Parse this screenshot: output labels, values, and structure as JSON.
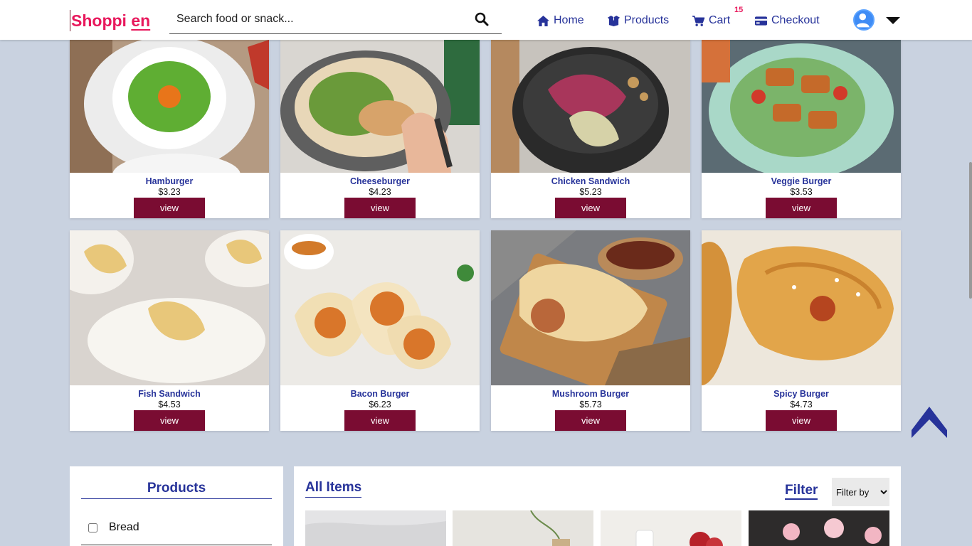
{
  "navbar": {
    "brand_part1": "Shoppi ",
    "brand_part2": "en",
    "search_placeholder": "Search food or snack...",
    "search_icon": "search-icon",
    "links": [
      {
        "label": "Home",
        "icon": "home-icon"
      },
      {
        "label": "Products",
        "icon": "box-icon"
      },
      {
        "label": "Cart",
        "icon": "cart-icon"
      },
      {
        "label": "Checkout",
        "icon": "credit-card-icon"
      }
    ],
    "cart_count": "15"
  },
  "products": [
    {
      "name": "Hamburger",
      "price": "$3.23",
      "button": "view"
    },
    {
      "name": "Cheeseburger",
      "price": "$4.23",
      "button": "view"
    },
    {
      "name": "Chicken Sandwich",
      "price": "$5.23",
      "button": "view"
    },
    {
      "name": "Veggie Burger",
      "price": "$3.53",
      "button": "view"
    },
    {
      "name": "Fish Sandwich",
      "price": "$4.53",
      "button": "view"
    },
    {
      "name": "Bacon Burger",
      "price": "$6.23",
      "button": "view"
    },
    {
      "name": "Mushroom Burger",
      "price": "$5.73",
      "button": "view"
    },
    {
      "name": "Spicy Burger",
      "price": "$4.73",
      "button": "view"
    }
  ],
  "sidebar": {
    "title": "Products",
    "categories": [
      {
        "label": "Bread",
        "checked": false
      }
    ]
  },
  "main": {
    "title": "All Items",
    "filter_label": "Filter",
    "filter_select": "Filter by"
  },
  "colors": {
    "brand": "#e8185c",
    "accent": "#27339a",
    "button": "#7a0c32",
    "background": "#c9d2e0"
  }
}
